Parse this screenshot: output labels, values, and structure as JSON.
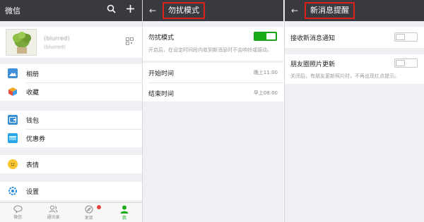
{
  "colors": {
    "topbar": "#393a3f",
    "accent": "#1aad19",
    "highlight_box": "#e0201b",
    "badge": "#e64340",
    "background": "#efeff4"
  },
  "panel1": {
    "title": "微信",
    "icons": [
      "search-icon",
      "plus-icon"
    ],
    "profile": {
      "name": "(blurred)",
      "id": "(blurred)"
    },
    "menu": {
      "album": "相册",
      "favorites": "收藏",
      "wallet": "钱包",
      "coupons": "优惠券",
      "stickers": "表情",
      "settings": "设置"
    },
    "tabs": [
      {
        "label": "微信",
        "icon": "chat-icon"
      },
      {
        "label": "通讯录",
        "icon": "contacts-icon"
      },
      {
        "label": "发现",
        "icon": "compass-icon"
      },
      {
        "label": "我",
        "icon": "me-icon"
      }
    ]
  },
  "panel2": {
    "back": "←",
    "title": "勿扰模式",
    "dnd_label": "勿扰模式",
    "dnd_on": true,
    "dnd_desc": "开启后，在设定时间段内收到新消息时不会响铃或振动。",
    "start_label": "开始时间",
    "start_value": "晚上11:00",
    "end_label": "结束时间",
    "end_value": "早上08:00"
  },
  "panel3": {
    "back": "←",
    "title": "新消息提醒",
    "receive_label": "接收新消息通知",
    "receive_on": false,
    "moments_label": "朋友圈照片更新",
    "moments_on": false,
    "moments_desc": "关闭后，有朋友更新照片时，不再出现红点提示。"
  }
}
